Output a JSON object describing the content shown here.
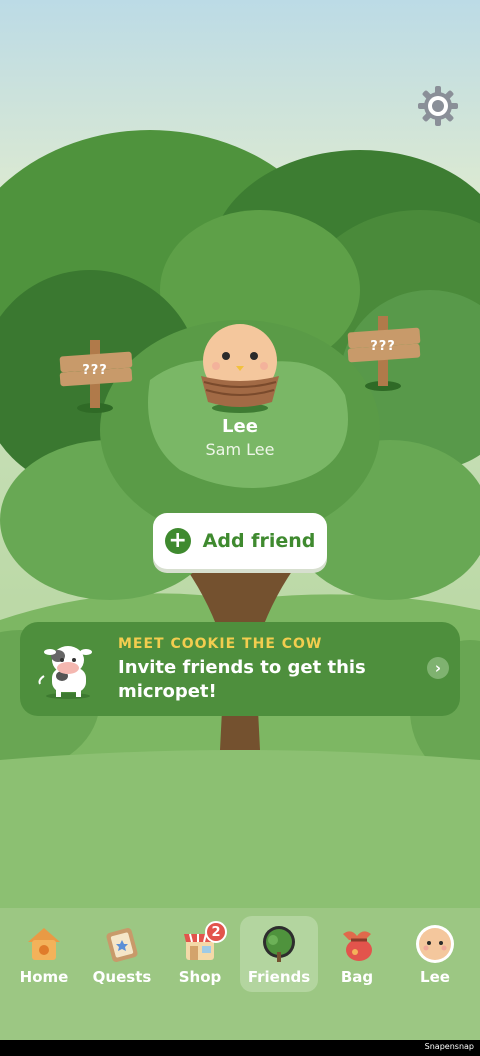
{
  "player": {
    "display_name": "Lee",
    "full_name": "Sam Lee"
  },
  "signs": {
    "left": "???",
    "right": "???"
  },
  "actions": {
    "add_friend": "Add friend"
  },
  "promo": {
    "kicker": "MEET COOKIE THE COW",
    "body": "Invite friends to get this micropet!"
  },
  "nav": {
    "items": [
      {
        "label": "Home",
        "icon": "house-icon"
      },
      {
        "label": "Quests",
        "icon": "quest-scroll-icon"
      },
      {
        "label": "Shop",
        "icon": "shop-icon",
        "badge": "2"
      },
      {
        "label": "Friends",
        "icon": "tree-icon",
        "active": true
      },
      {
        "label": "Bag",
        "icon": "bag-icon"
      },
      {
        "label": "Lee",
        "icon": "avatar-icon"
      }
    ]
  },
  "footer": {
    "credit": "Snapensnap"
  },
  "colors": {
    "accent_green": "#3f8a2f",
    "promo_kicker": "#f2cd4f",
    "badge_red": "#e2544c"
  }
}
